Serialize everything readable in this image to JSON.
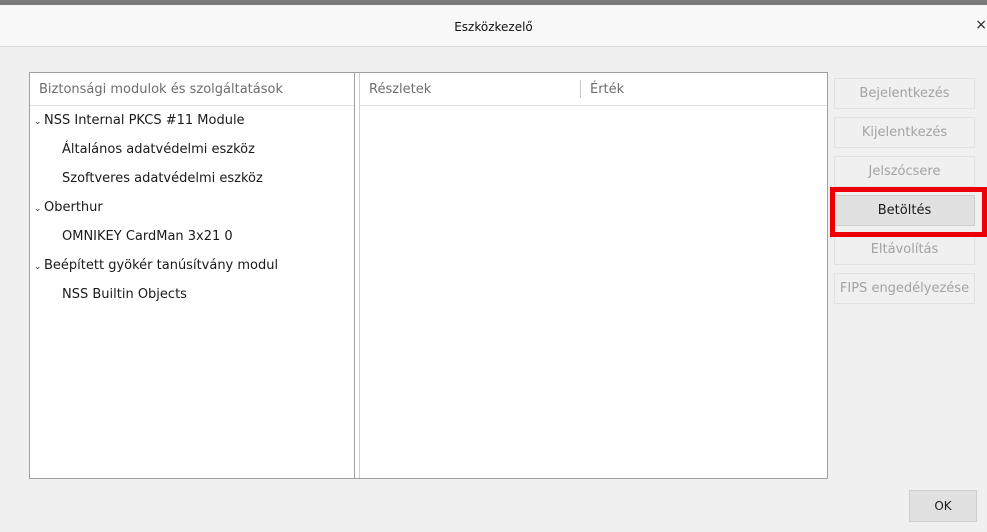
{
  "window": {
    "title": "Eszközkezelő",
    "close_glyph": "×"
  },
  "tree": {
    "header": "Biztonsági modulok és szolgáltatások",
    "twisty_glyph": "⌄",
    "items": [
      {
        "label": "NSS Internal PKCS #11 Module",
        "level": 0,
        "expanded": true
      },
      {
        "label": "Általános adatvédelmi eszköz",
        "level": 1
      },
      {
        "label": "Szoftveres adatvédelmi eszköz",
        "level": 1
      },
      {
        "label": "Oberthur",
        "level": 0,
        "expanded": true
      },
      {
        "label": "OMNIKEY CardMan 3x21 0",
        "level": 1
      },
      {
        "label": "Beépített gyökér tanúsítvány modul",
        "level": 0,
        "expanded": true
      },
      {
        "label": "NSS Builtin Objects",
        "level": 1
      }
    ]
  },
  "details": {
    "col_details": "Részletek",
    "col_value": "Érték"
  },
  "buttons": {
    "login": "Bejelentkezés",
    "logout": "Kijelentkezés",
    "change_password": "Jelszócsere",
    "load": "Betöltés",
    "remove": "Eltávolítás",
    "enable_fips": "FIPS engedélyezése",
    "ok": "OK"
  },
  "colors": {
    "highlight": "#ef0000"
  }
}
